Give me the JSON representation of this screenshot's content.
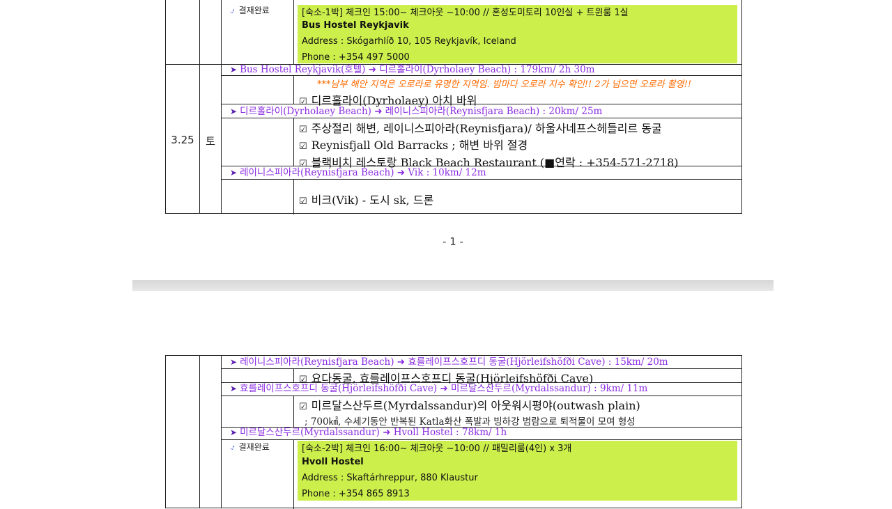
{
  "page1": {
    "stay1": {
      "status": "결재완료",
      "header": "[숙소-1박] 체크인 15:00~ 체크아웃 ~10:00 // 혼성도미토리 10인실 + 트윈룸 1실",
      "name": "Bus Hostel Reykjavik",
      "address": "Address : Skógarhlíð 10, 105 Reykjavík, Iceland",
      "phone": "Phone : +354 497 5000"
    },
    "day": {
      "date": "3.25",
      "weekday": "토"
    },
    "route1": "Bus Hostel Reykjavik(호텔) ➜ 디르홀라이(Dyrholaey Beach) : 179km/ 2h 30m",
    "note1": "***남부 해안 지역은 오로라로 유명한 지역임. 밤마다 오로라 지수 확인!! 2가 넘으면 오로라 촬영!!",
    "check1": "디르홀라이(Dyrholaey) 아치 바위",
    "route2": "디르홀라이(Dyrholaey Beach) ➜ 레이니스피아라(Reynisfjara Beach) : 20km/ 25m",
    "check2": "주상절리 해변, 레이니스피아라(Reynisfjara)/ 하울사네프스헤들리르 동굴",
    "check3": "Reynisfjall Old Barracks ; 해변 바위 절경",
    "check4": "블랙비치 레스토랑 Black Beach Restaurant (■연락 : +354-571-2718)",
    "route3": "레이니스피아라(Reynisfjara Beach) ➜ Vik : 10km/ 12m",
    "check5": "비크(Vik) - 도시 sk, 드론",
    "page_number": "- 1 -"
  },
  "page2": {
    "route1": "레이니스피아라(Reynisfjara Beach) ➜ 효를레이프스호프디 동굴(Hjörleifshöfði Cave) : 15km/ 20m",
    "check1": "요다동굴, 효를레이프스호프디 동굴(Hjörleifshöfði Cave)",
    "route2": "효를레이프스호프디 동굴(Hjörleifshöfði Cave) ➜ 미르달스산두르(Myrdalssandur) : 9km/ 11m",
    "check2": "미르달스산두르(Myrdalssandur)의 아웃워시평야(outwash plain)",
    "detail2": "; 700㎢, 수세기동안 반복된 Katla화산 폭발과 빙하강 범람으로 퇴적물이 모여 형성",
    "route3": "미르달스산두르(Myrdalssandur) ➜ Hvoll Hostel : 78km/ 1h",
    "stay2": {
      "status": "결재완료",
      "header": "[숙소-2박] 체크인 16:00~ 체크아웃 ~10:00 // 패밀리룸(4인) x 3개",
      "name": "Hvoll Hostel",
      "address": "Address : Skaftárhreppur, 880 Klaustur",
      "phone": "Phone : +354 865 8913"
    }
  },
  "icons": {
    "route_arrow": "arrow-marker-icon",
    "checkbox": "checked-box-icon",
    "paid": "paid-stamp-icon"
  },
  "colors": {
    "highlight": "#cdef4c",
    "route_text": "#8a2be2",
    "note_text": "#ff6a00"
  }
}
